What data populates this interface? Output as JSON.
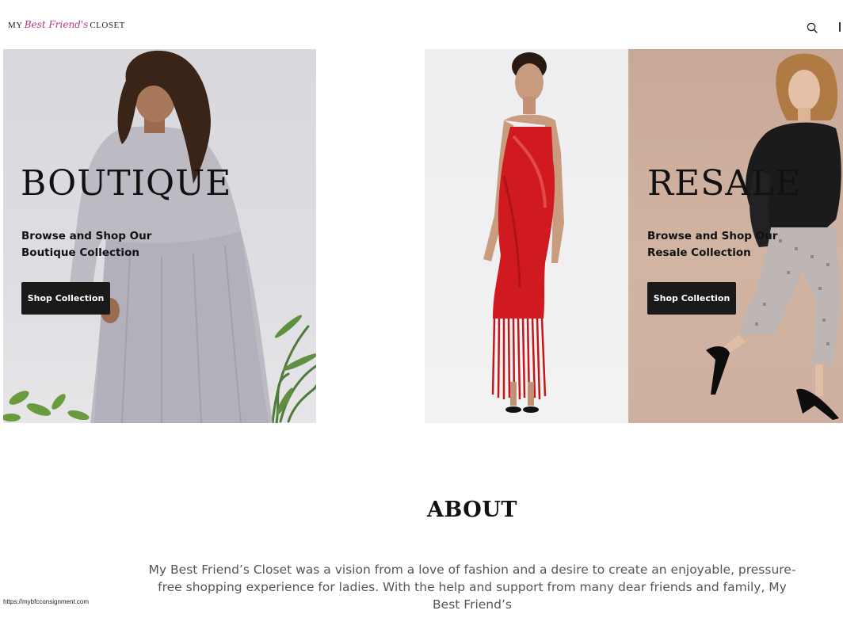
{
  "header": {
    "logo": {
      "part1": "MY",
      "part2": "Best Friend's",
      "part3": "CLOSET"
    },
    "search_icon": "search-icon"
  },
  "hero": {
    "boutique": {
      "title": "BOUTIQUE",
      "subtitle_line1": "Browse and Shop Our",
      "subtitle_line2": "Boutique Collection",
      "button_label": "Shop Collection"
    },
    "resale": {
      "title": "RESALE",
      "subtitle_line1": "Browse and Shop Our",
      "subtitle_line2": "Resale Collection",
      "button_label": "Shop Collection"
    }
  },
  "about": {
    "title": "ABOUT",
    "text": "My Best Friend’s Closet was a vision from a love of fashion and a desire to create an enjoyable, pressure-free shopping experience for ladies. With the help and support from many dear friends and family, My Best Friend’s"
  },
  "status_bar": {
    "url": "https://mybfcconsignment.com"
  },
  "colors": {
    "accent_logo": "#b5367e",
    "button_bg": "#1a1a1a",
    "boutique_bg": "#dcdbdf",
    "resale_bg": "#cdae9c",
    "dress_red": "#d01a1f"
  }
}
